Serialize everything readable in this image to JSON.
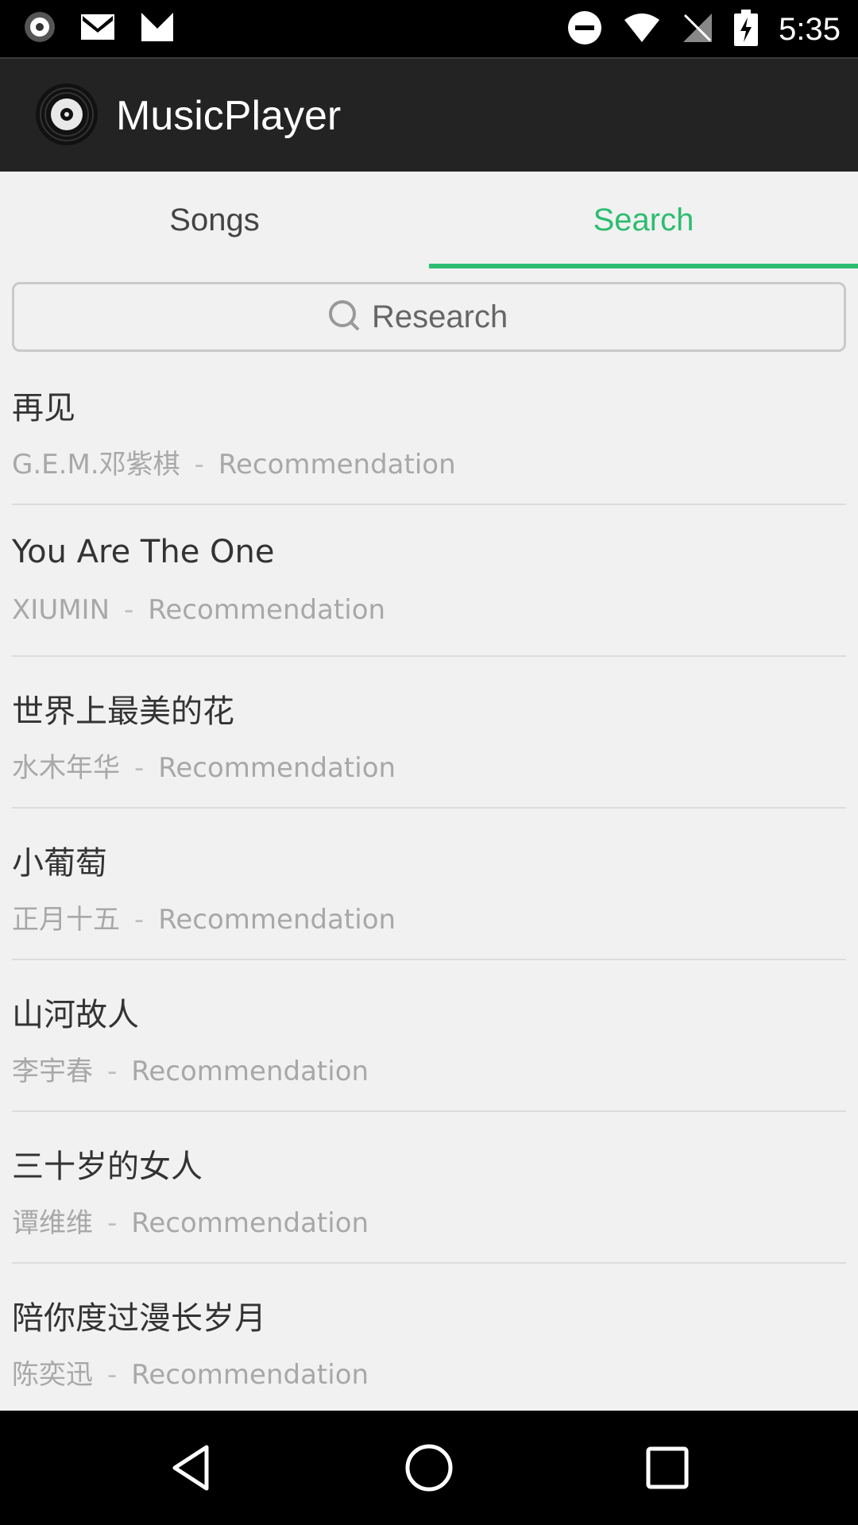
{
  "status_bar": {
    "time": "5:35",
    "left_icons": [
      "music-disc-icon",
      "gmail-icon",
      "gmail-icon"
    ],
    "right_icons": [
      "do-not-disturb-icon",
      "wifi-icon",
      "no-signal-icon",
      "battery-charging-icon"
    ]
  },
  "app_bar": {
    "title": "MusicPlayer",
    "logo_icon": "vinyl-disc-icon"
  },
  "tabs": [
    {
      "label": "Songs",
      "active": false
    },
    {
      "label": "Search",
      "active": true
    }
  ],
  "search": {
    "placeholder": "Research",
    "icon": "search-icon"
  },
  "results": [
    {
      "title": "再见",
      "artist": "G.E.M.邓紫棋",
      "separator": "-",
      "tag": "Recommendation"
    },
    {
      "title": "You Are The One",
      "artist": "XIUMIN",
      "separator": "-",
      "tag": "Recommendation"
    },
    {
      "title": "世界上最美的花",
      "artist": "水木年华",
      "separator": "-",
      "tag": "Recommendation"
    },
    {
      "title": "小葡萄",
      "artist": "正月十五",
      "separator": "-",
      "tag": "Recommendation"
    },
    {
      "title": "山河故人",
      "artist": "李宇春",
      "separator": "-",
      "tag": "Recommendation"
    },
    {
      "title": "三十岁的女人",
      "artist": "谭维维",
      "separator": "-",
      "tag": "Recommendation"
    },
    {
      "title": "陪你度过漫长岁月",
      "artist": "陈奕迅",
      "separator": "-",
      "tag": "Recommendation"
    }
  ],
  "colors": {
    "accent": "#2dbd70",
    "app_bar": "#232323",
    "background": "#f1f1f1"
  },
  "nav_bar": {
    "buttons": [
      "back-icon",
      "home-icon",
      "recents-icon"
    ]
  }
}
